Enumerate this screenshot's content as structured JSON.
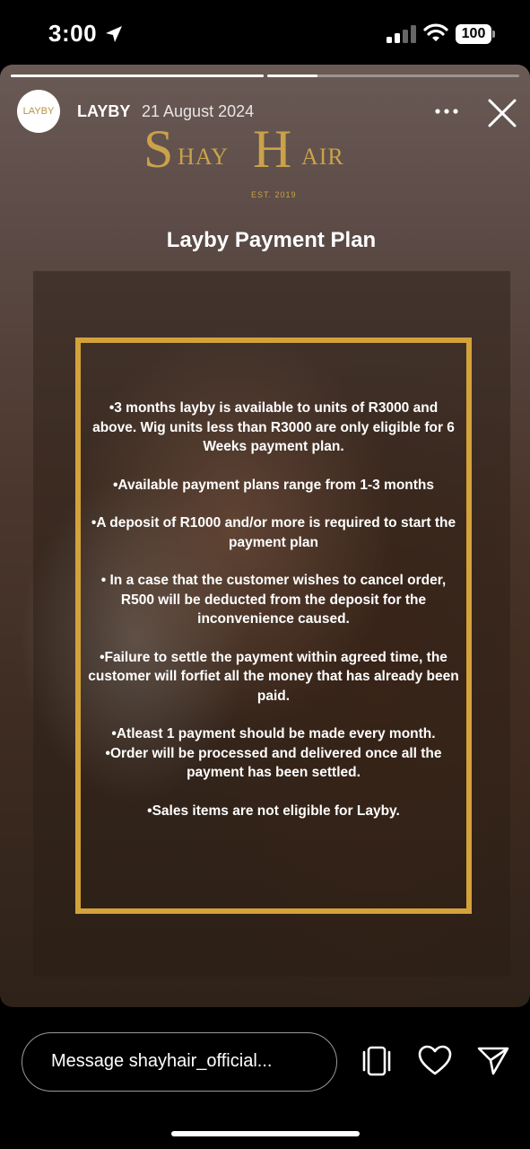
{
  "status_bar": {
    "time": "3:00",
    "battery": "100"
  },
  "story": {
    "progress_segments": [
      {
        "fill": 1.0
      },
      {
        "fill": 0.2
      }
    ],
    "avatar_text": "LAYBY",
    "username": "LAYBY",
    "date": "21 August 2024",
    "logo": {
      "s": "S",
      "hay": "HAY",
      "h": "H",
      "air": "AIR",
      "est": "EST. 2019"
    },
    "title": "Layby Payment Plan",
    "terms": [
      "•3 months layby is available to units of R3000 and above. Wig units less than R3000 are only eligible for 6 Weeks payment plan.",
      "•Available payment plans range from 1-3 months",
      "•A deposit of R1000 and/or more is  required to start the payment plan",
      "• In a case that the customer wishes to cancel order, R500 will be deducted from the deposit for the inconvenience caused.",
      "•Failure to settle the payment within agreed time, the customer will forfiet all the  money that has already been paid.",
      "•Atleast 1 payment should be made every month.",
      "•Order will be processed and delivered once all the payment has been settled.",
      "•Sales items are not eligible for Layby."
    ]
  },
  "bottom_bar": {
    "message_placeholder": "Message shayhair_official..."
  },
  "colors": {
    "gold": "#d4a23a",
    "logo_gold": "#c9a24a"
  },
  "icons": [
    "location-arrow-icon",
    "signal-icon",
    "wifi-icon",
    "battery-icon",
    "more-icon",
    "close-icon",
    "share-story-icon",
    "heart-icon",
    "send-icon"
  ]
}
